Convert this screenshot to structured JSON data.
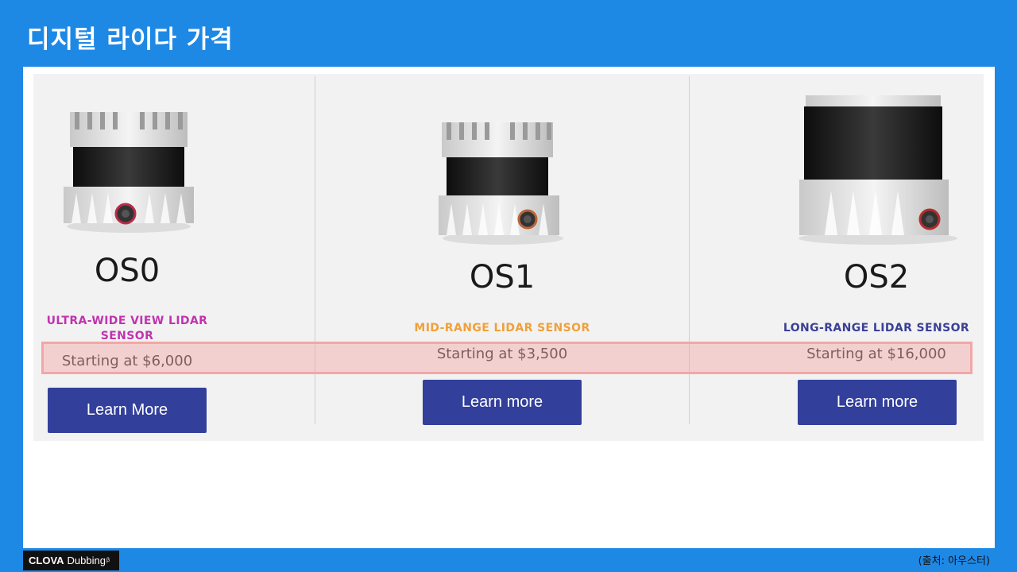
{
  "slide": {
    "title": "디지털 라이다 가격"
  },
  "products": [
    {
      "model": "OS0",
      "type": "ULTRA-WIDE VIEW LIDAR SENSOR",
      "type_color": "#c232b0",
      "price": "Starting at $6,000",
      "button": "Learn More",
      "image_icon": "lidar-sensor-image"
    },
    {
      "model": "OS1",
      "type": "MID-RANGE LIDAR SENSOR",
      "type_color": "#f0a03a",
      "price": "Starting at $3,500",
      "button": "Learn more",
      "image_icon": "lidar-sensor-image"
    },
    {
      "model": "OS2",
      "type": "LONG-RANGE LIDAR SENSOR",
      "type_color": "#3a3f96",
      "price": "Starting at $16,000",
      "button": "Learn more",
      "image_icon": "lidar-sensor-image"
    }
  ],
  "footer": {
    "logo_bold": "CLOVA",
    "logo_text": "Dubbing",
    "logo_mark": "β",
    "source": "(출처: 아우스터)"
  },
  "colors": {
    "background": "#1e88e5",
    "button": "#323f9b",
    "highlight": "#f4a6a6",
    "panel": "#f2f2f2"
  }
}
